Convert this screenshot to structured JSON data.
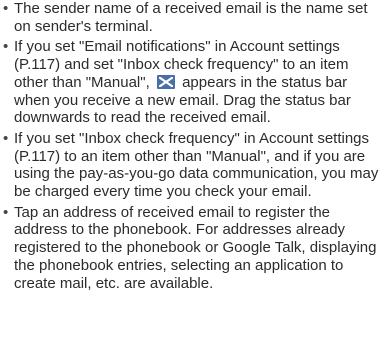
{
  "notes": [
    {
      "bullet": "•",
      "text": "The sender name of a received email is the name set on sender's terminal."
    },
    {
      "bullet": "•",
      "text_before_icon": "If you set \"Email notifications\" in Account settings (P.117) and set \"Inbox check frequency\" to an item other than \"Manual\",",
      "icon": "new-email-status-icon",
      "text_after_icon": "appears in the status bar when you receive a new email. Drag the status bar downwards to read the received email."
    },
    {
      "bullet": "•",
      "text": "If you set \"Inbox check frequency\" in Account settings (P.117) to an item other than \"Manual\", and if you are using the pay-as-you-go data communication, you may be charged every time you check your email."
    },
    {
      "bullet": "•",
      "text": "Tap an address of received email to register the address to the phonebook. For addresses already registered to the phonebook or Google Talk, displaying the phonebook entries, selecting an application to create mail, etc. are available."
    }
  ],
  "colors": {
    "text": "#2b2b2b",
    "icon_background": "#4a6ea8",
    "icon_glyph": "#ffffff"
  }
}
